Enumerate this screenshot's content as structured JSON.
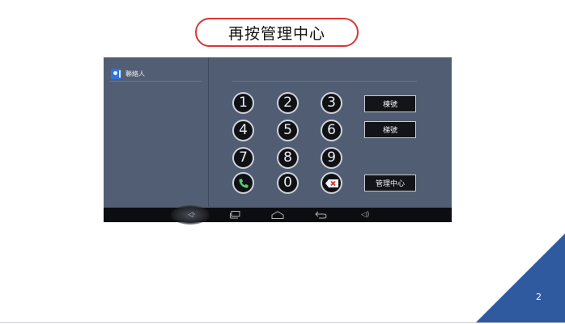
{
  "slide": {
    "title": "再按管理中心",
    "page_number": "2",
    "accent_color": "#d8363a",
    "corner_color": "#2f5aa0"
  },
  "app": {
    "contacts_label": "聯絡人",
    "keypad": {
      "keys": [
        "1",
        "2",
        "3",
        "4",
        "5",
        "6",
        "7",
        "8",
        "9",
        "call",
        "0",
        "delete"
      ]
    },
    "buttons": {
      "building_no": "棟號",
      "stair_no": "梯號",
      "management_center": "管理中心"
    },
    "navbar": {
      "icons": [
        "volume-down-icon",
        "recent-apps-icon",
        "home-icon",
        "back-icon",
        "volume-up-icon"
      ]
    }
  }
}
